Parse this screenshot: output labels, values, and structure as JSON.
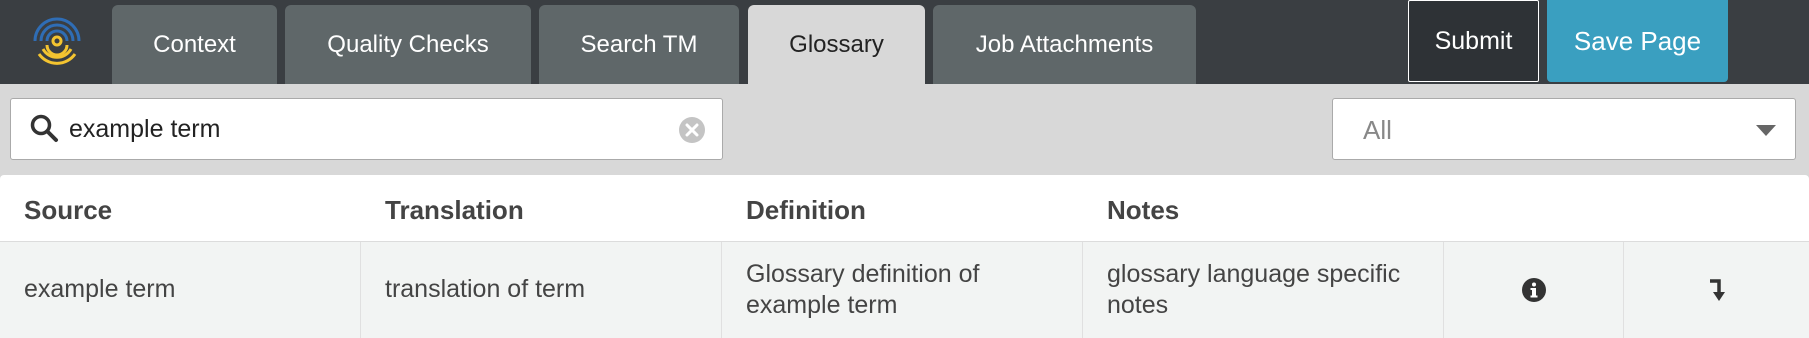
{
  "tabs": [
    {
      "label": "Context",
      "active": false
    },
    {
      "label": "Quality Checks",
      "active": false
    },
    {
      "label": "Search TM",
      "active": false
    },
    {
      "label": "Glossary",
      "active": true
    },
    {
      "label": "Job Attachments",
      "active": false
    }
  ],
  "actions": {
    "submit_label": "Submit",
    "save_label": "Save Page"
  },
  "search": {
    "value": "example term"
  },
  "filter": {
    "selected": "All"
  },
  "table": {
    "columns": [
      "Source",
      "Translation",
      "Definition",
      "Notes"
    ],
    "rows": [
      {
        "source": "example term",
        "translation": "translation of term",
        "definition_line1": "Glossary definition of",
        "definition_line2": "example term",
        "notes_line1": "glossary language specific",
        "notes_line2": "notes"
      }
    ]
  },
  "icons": {
    "logo": "fingerprint-logo-icon",
    "search": "search-icon",
    "clear": "clear-icon",
    "caret": "chevron-down-icon",
    "info": "info-icon",
    "insert": "insert-arrow-icon"
  },
  "colors": {
    "topbar": "#3a3e42",
    "tab": "#5f6769",
    "tab_active": "#d8d8d8",
    "save_button": "#3a9fc0",
    "logo_blue": "#2f6db5",
    "logo_yellow": "#f4c430"
  }
}
